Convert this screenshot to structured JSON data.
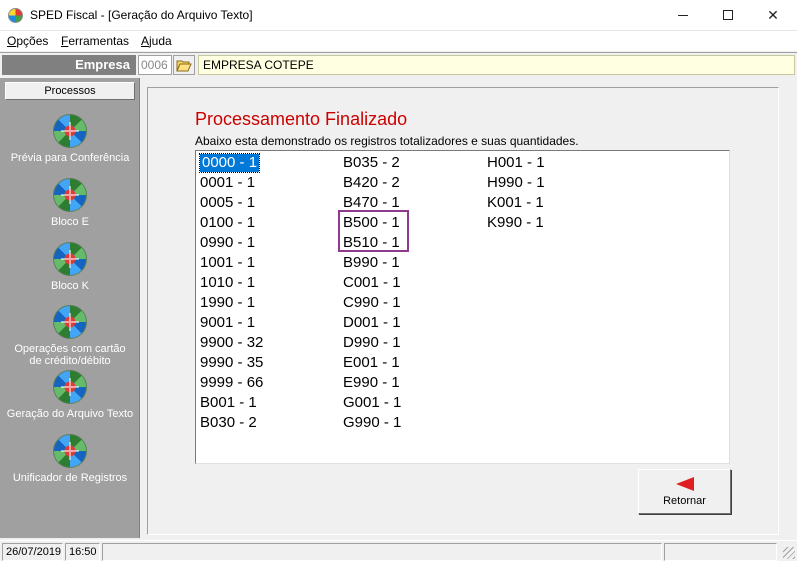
{
  "window": {
    "title": "SPED Fiscal - [Geração do Arquivo Texto]",
    "icons": {
      "app": "app-globe-icon",
      "minimize": "minimize-icon",
      "maximize": "maximize-icon",
      "close": "close-icon"
    },
    "close_glyph": "✕"
  },
  "menu": {
    "items": [
      {
        "label": "Opções",
        "accel": "O",
        "rest": "pções"
      },
      {
        "label": "Ferramentas",
        "accel": "F",
        "rest": "erramentas"
      },
      {
        "label": "Ajuda",
        "accel": "A",
        "rest": "juda"
      }
    ]
  },
  "company": {
    "label": "Empresa",
    "code": "0006",
    "name": "EMPRESA COTEPE",
    "folder_icon": "folder-open-icon"
  },
  "sidebar": {
    "header": "Processos",
    "items": [
      {
        "label": "Prévia para Conferência",
        "icon": "globe-icon"
      },
      {
        "label": "Bloco E",
        "icon": "globe-icon"
      },
      {
        "label": "Bloco K",
        "icon": "globe-icon"
      },
      {
        "label": "Operações com cartão de crédito/débito",
        "icon": "globe-icon"
      },
      {
        "label": "Geração do Arquivo Texto",
        "icon": "globe-icon"
      },
      {
        "label": "Unificador de Registros",
        "icon": "globe-icon"
      }
    ]
  },
  "main": {
    "heading": "Processamento Finalizado",
    "subheading": "Abaixo esta demonstrado os registros totalizadores e suas quantidades.",
    "records": {
      "col1": [
        "0000 - 1",
        "0001 - 1",
        "0005 - 1",
        "0100 - 1",
        "0990 - 1",
        "1001 - 1",
        "1010 - 1",
        "1990 - 1",
        "9001 - 1",
        "9900 - 32",
        "9990 - 35",
        "9999 - 66",
        "B001 - 1",
        "B030 - 2"
      ],
      "col2": [
        "B035 - 2",
        "B420 - 2",
        "B470 - 1",
        "B500 - 1",
        "B510 - 1",
        "B990 - 1",
        "C001 - 1",
        "C990 - 1",
        "D001 - 1",
        "D990 - 1",
        "E001 - 1",
        "E990 - 1",
        "G001 - 1",
        "G990 - 1"
      ],
      "col3": [
        "H001 - 1",
        "H990 - 1",
        "K001 - 1",
        "K990 - 1"
      ],
      "selected": "0000 - 1"
    },
    "return_button": {
      "label": "Retornar",
      "icon": "arrow-left-icon",
      "icon_color": "#e02020"
    }
  },
  "status": {
    "date": "26/07/2019",
    "time": "16:50"
  },
  "colors": {
    "heading": "#cc0000",
    "selection": "#0078d7",
    "company_bg": "#ffffe1",
    "sidebar_bg": "#a0a0a0",
    "highlight_box": "#8e3a8e"
  }
}
